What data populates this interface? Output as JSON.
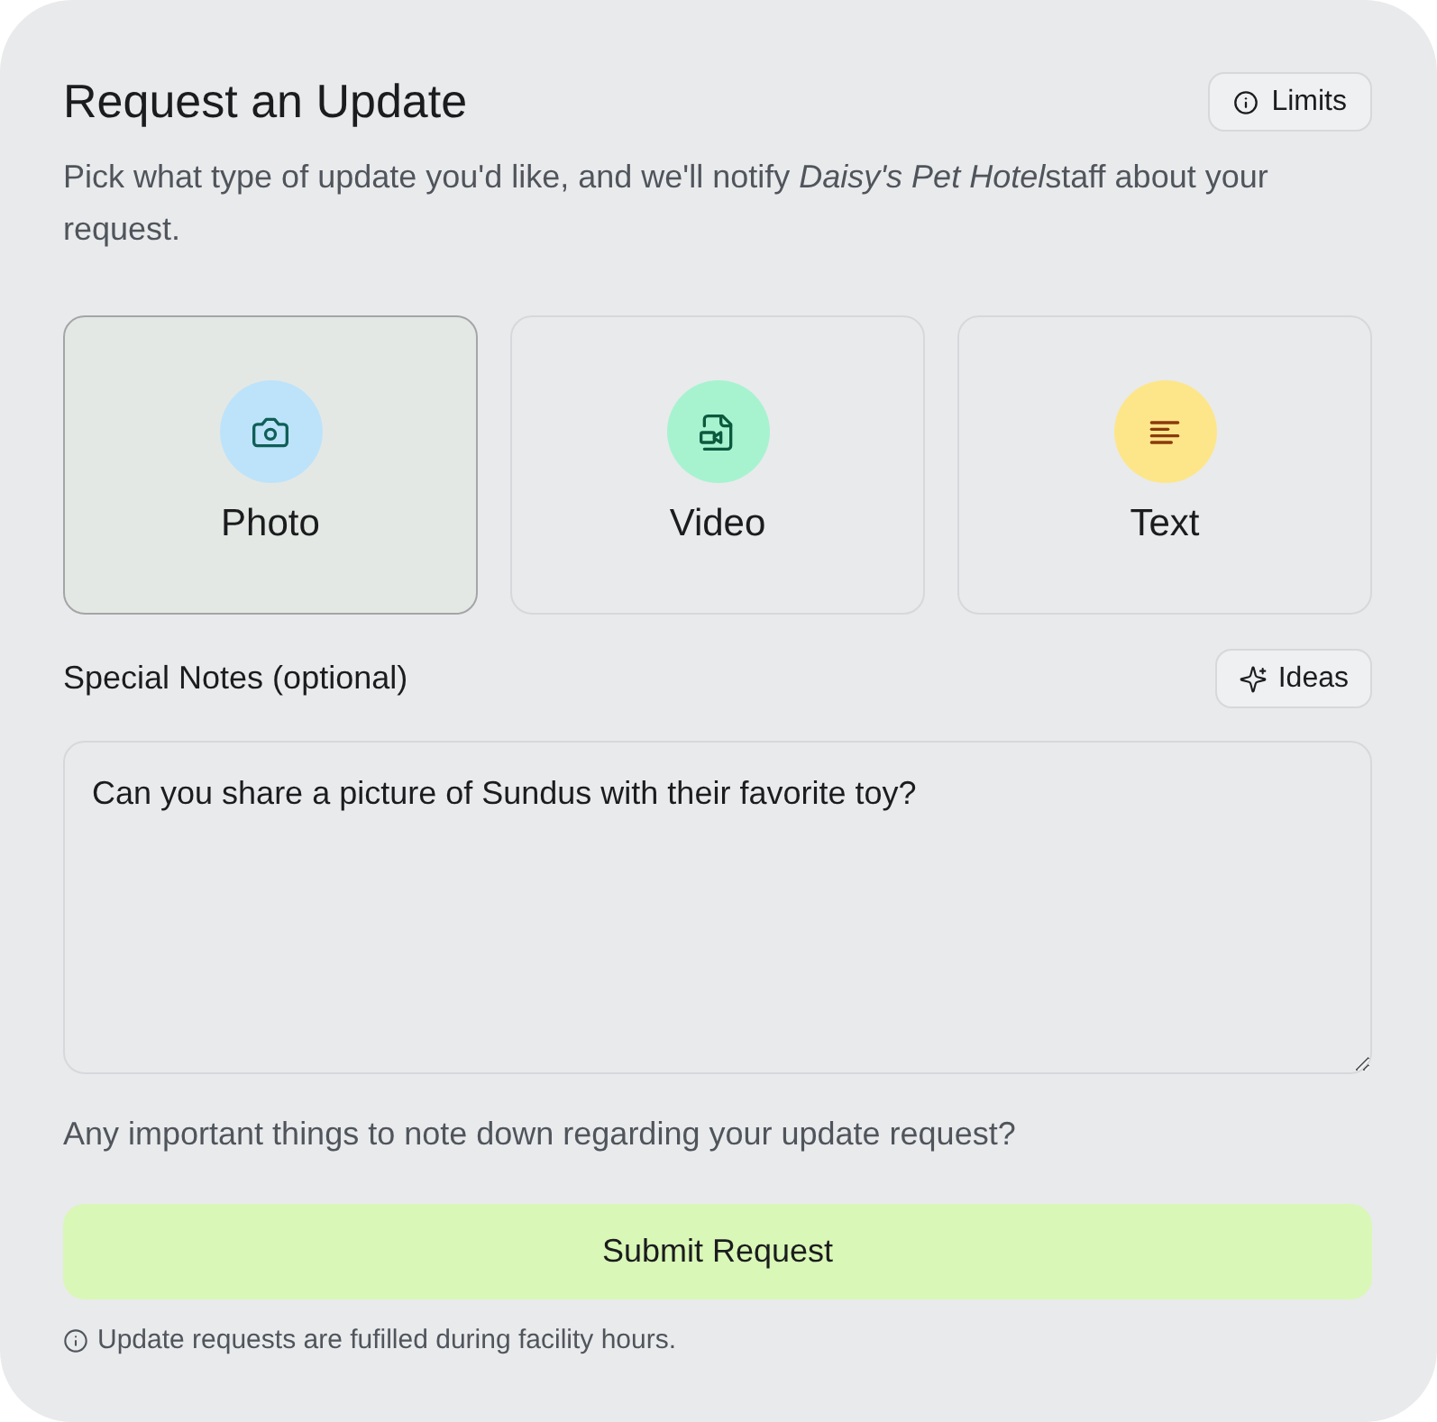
{
  "header": {
    "title": "Request an Update",
    "limits_button": "Limits"
  },
  "description": [
    {
      "text": "Pick what type of update you'd like, and we'll notify ",
      "italic": false
    },
    {
      "text": "Daisy's Pet Hotel",
      "italic": true
    },
    {
      "text": "staff about your request.",
      "italic": false
    }
  ],
  "update_types": [
    {
      "kind": "photo",
      "label": "Photo",
      "selected": true,
      "color": "#bde3fb"
    },
    {
      "kind": "video",
      "label": "Video",
      "selected": false,
      "color": "#a7f3d0"
    },
    {
      "kind": "text",
      "label": "Text",
      "selected": false,
      "color": "#fde68a"
    }
  ],
  "notes": {
    "label": "Special Notes (optional)",
    "ideas_button": "Ideas",
    "value": "Can you share a picture of Sundus with their favorite toy?",
    "helper": "Any important things to note down regarding your update request?"
  },
  "submit_button": "Submit Request",
  "footnote": "Update requests are fufilled during facility hours."
}
